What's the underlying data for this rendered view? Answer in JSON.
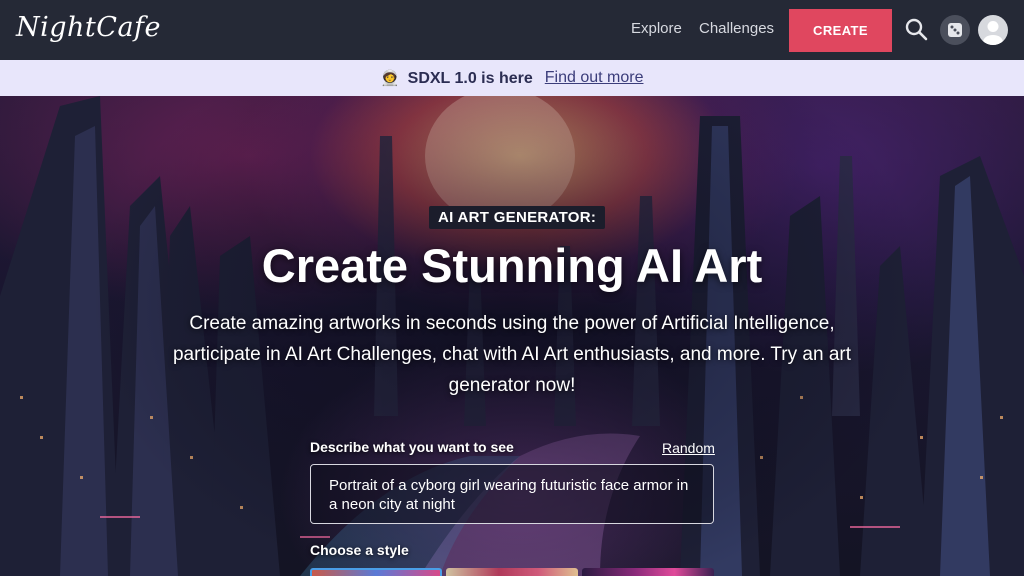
{
  "nav": {
    "logo": "NightCafe",
    "links": [
      "Explore",
      "Challenges"
    ],
    "create_label": "CREATE"
  },
  "banner": {
    "emoji": "🧑‍🚀",
    "text": "SDXL 1.0 is here",
    "link": "Find out more"
  },
  "hero": {
    "kicker": "AI ART GENERATOR:",
    "title": "Create Stunning AI Art",
    "subtitle": "Create amazing artworks in seconds using the power of Artificial Intelligence, participate in AI Art Challenges, chat with AI Art enthusiasts, and more. Try an art generator now!"
  },
  "prompt": {
    "label": "Describe what you want to see",
    "random_label": "Random",
    "value": "Portrait of a cyborg girl wearing futuristic face armor in a neon city at night"
  },
  "style": {
    "label": "Choose a style"
  },
  "colors": {
    "nav_bg": "#252936",
    "accent": "#e0475f",
    "banner_bg": "#e8e6fb",
    "selected_style_border": "#4a9fe8"
  },
  "icons": [
    "search-icon",
    "dice-icon",
    "user-avatar-icon"
  ]
}
